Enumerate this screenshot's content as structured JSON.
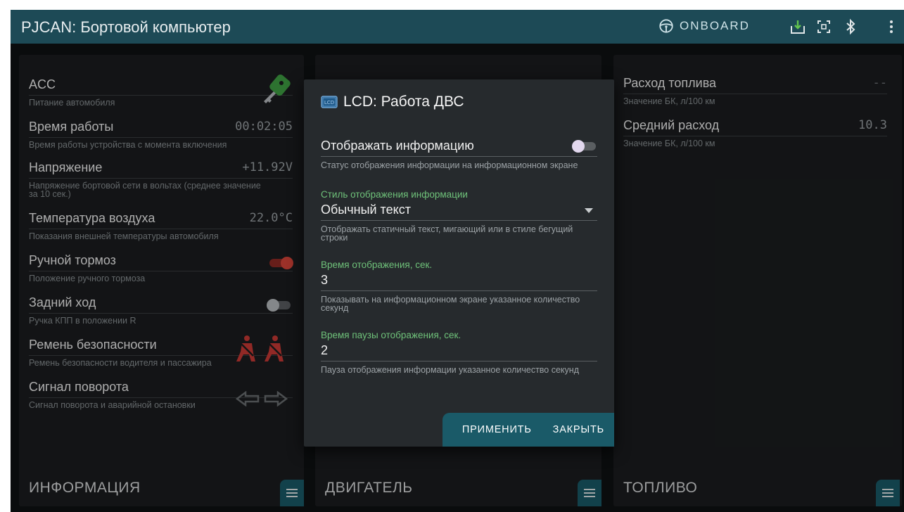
{
  "app": {
    "title": "PJCAN: Бортовой компьютер",
    "onboard_label": "ONBOARD",
    "bar_color": "#1d4a56"
  },
  "panels": {
    "info": {
      "name": "ИНФОРМАЦИЯ",
      "rows": [
        {
          "title": "ACC",
          "value": "",
          "desc": "Питание автомобиля"
        },
        {
          "title": "Время работы",
          "value": "00:02:05",
          "desc": "Время работы устройства с момента включения"
        },
        {
          "title": "Напряжение",
          "value": "+11.92V",
          "desc": "Напряжение бортовой сети в вольтах (среднее значение за 10 сек.)"
        },
        {
          "title": "Температура воздуха",
          "value": "22.0°C",
          "desc": "Показания внешней температуры автомобиля"
        },
        {
          "title": "Ручной тормоз",
          "value": "",
          "desc": "Положение ручного тормоза",
          "toggle": true
        },
        {
          "title": "Задний ход",
          "value": "",
          "desc": "Ручка КПП в положении R",
          "toggle": false
        },
        {
          "title": "Ремень безопасности",
          "value": "",
          "desc": "Ремень безопасности водителя и пассажира"
        },
        {
          "title": "Сигнал поворота",
          "value": "",
          "desc": "Сигнал поворота и аварийной остановки"
        }
      ]
    },
    "engine": {
      "name": "ДВИГАТЕЛЬ"
    },
    "fuel": {
      "name": "ТОПЛИВО",
      "rows": [
        {
          "title": "Расход топлива",
          "value": "--",
          "desc": "Значение БК, л/100 км"
        },
        {
          "title": "Средний расход",
          "value": "10.3",
          "desc": "Значение БК, л/100 км"
        }
      ]
    }
  },
  "dialog": {
    "badge": "LCD",
    "title": "LCD: Работа ДВС",
    "show_info": {
      "label": "Отображать информацию",
      "desc": "Статус отображения информации на информационном экране",
      "on": false
    },
    "style": {
      "label": "Стиль отображения информации",
      "value": "Обычный текст",
      "desc": "Отображать статичный текст, мигающий или в стиле бегущий строки"
    },
    "display_time": {
      "label": "Время отображения, сек.",
      "value": "3",
      "desc": "Показывать на информационном экране указанное количество секунд"
    },
    "pause_time": {
      "label": "Время паузы отображения, сек.",
      "value": "2",
      "desc": "Пауза отображения информации указанное количество секунд"
    },
    "apply_label": "ПРИМЕНИТЬ",
    "close_label": "ЗАКРЫТЬ"
  },
  "colors": {
    "accent": "#1a5a68",
    "label_green": "#6fc27a",
    "toggle_on": "#d8443a",
    "alert_red": "#c93a35"
  }
}
